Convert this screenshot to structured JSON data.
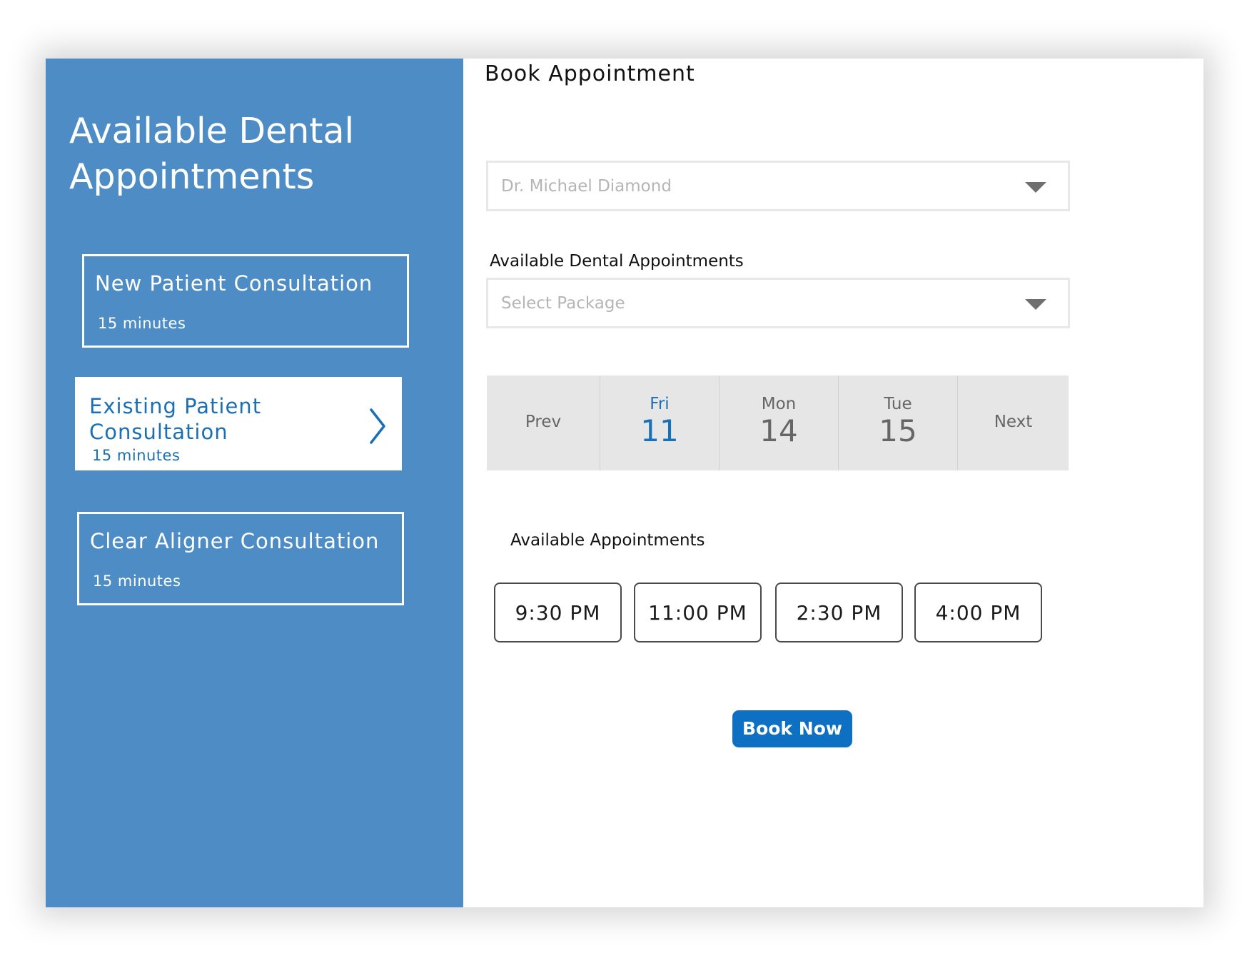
{
  "sidebar": {
    "title": "Available Dental Appointments",
    "packages": [
      {
        "name": "New Patient Consultation",
        "duration": "15 minutes"
      },
      {
        "name": "Existing Patient Consultation",
        "duration": "15 minutes"
      },
      {
        "name": "Clear Aligner Consultation",
        "duration": "15 minutes"
      }
    ],
    "selected_package": "Existing Patient Consultation"
  },
  "booking": {
    "title": "Book Appointment",
    "doctor_select": {
      "value": "Dr. Michael Diamond"
    },
    "package_label": "Available Dental Appointments",
    "package_select": {
      "placeholder": "Select Package"
    },
    "date_nav": {
      "prev_label": "Prev",
      "next_label": "Next",
      "days": [
        {
          "weekday": "Fri",
          "day": "11"
        },
        {
          "weekday": "Mon",
          "day": "14"
        },
        {
          "weekday": "Tue",
          "day": "15"
        }
      ],
      "selected_day": "11"
    },
    "slots_label": "Available Appointments",
    "time_slots": [
      "9:30 PM",
      "11:00 PM",
      "2:30 PM",
      "4:00 PM"
    ],
    "book_button": "Book Now"
  },
  "colors": {
    "sidebar_bg": "#4e8cc5",
    "accent": "#0e70c3",
    "selected_text": "#1a6fb5",
    "date_strip_bg": "#e6e6e6"
  }
}
